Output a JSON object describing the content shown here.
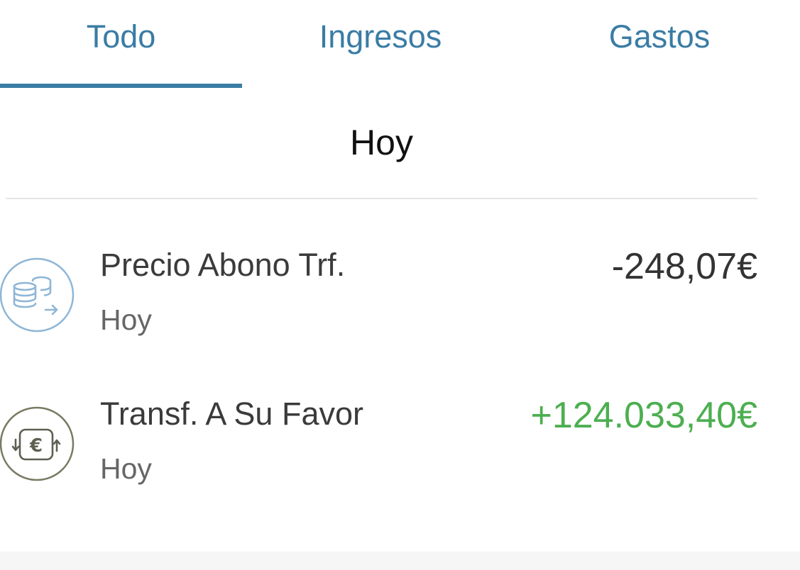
{
  "tabs": [
    {
      "label": "Todo",
      "active": true
    },
    {
      "label": "Ingresos",
      "active": false
    },
    {
      "label": "Gastos",
      "active": false
    }
  ],
  "colors": {
    "accent": "#3a7ca5",
    "positive_amount": "#4caf50",
    "text_primary": "#3b3b3b"
  },
  "section": {
    "title": "Hoy"
  },
  "transactions": [
    {
      "icon": "coins-transfer-icon",
      "title": "Precio Abono Trf.",
      "date": "Hoy",
      "amount": "-248,07€",
      "direction": "debit"
    },
    {
      "icon": "euro-exchange-icon",
      "title": "Transf. A Su Favor",
      "date": "Hoy",
      "amount": "+124.033,40€",
      "direction": "credit"
    }
  ]
}
